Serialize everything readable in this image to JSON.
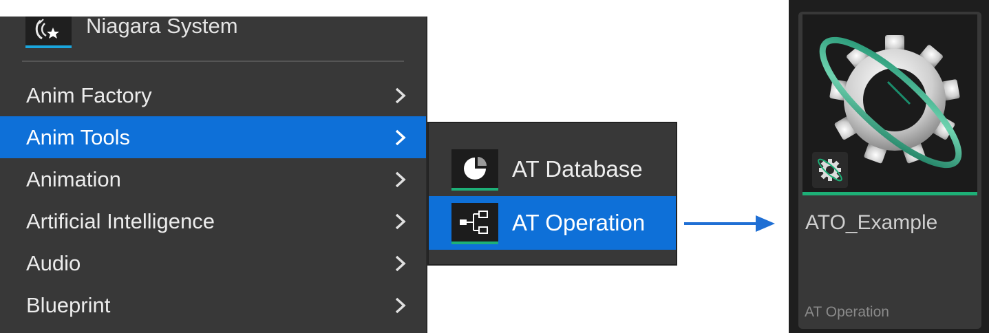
{
  "context_menu": {
    "top_item": {
      "label": "Niagara System",
      "icon": "niagara-system-icon"
    },
    "items": [
      {
        "label": "Anim Factory",
        "highlighted": false
      },
      {
        "label": "Anim Tools",
        "highlighted": true
      },
      {
        "label": "Animation",
        "highlighted": false
      },
      {
        "label": "Artificial Intelligence",
        "highlighted": false
      },
      {
        "label": "Audio",
        "highlighted": false
      },
      {
        "label": "Blueprint",
        "highlighted": false
      }
    ],
    "submenu_icon": "chevron-right-icon"
  },
  "submenu": {
    "items": [
      {
        "label": "AT Database",
        "icon": "pie-chart-icon",
        "highlighted": false
      },
      {
        "label": "AT Operation",
        "icon": "node-graph-icon",
        "highlighted": true
      }
    ]
  },
  "arrow": {
    "icon": "arrow-right-icon"
  },
  "asset": {
    "name": "ATO_Example",
    "type": "AT Operation",
    "thumbnail_icon": "gear-orbit-icon",
    "badge_icon": "gear-badge-icon"
  },
  "colors": {
    "menu_bg": "#383838",
    "highlight": "#0e70d8",
    "accent_green": "#1db077",
    "accent_blue": "#1aa5dc"
  }
}
